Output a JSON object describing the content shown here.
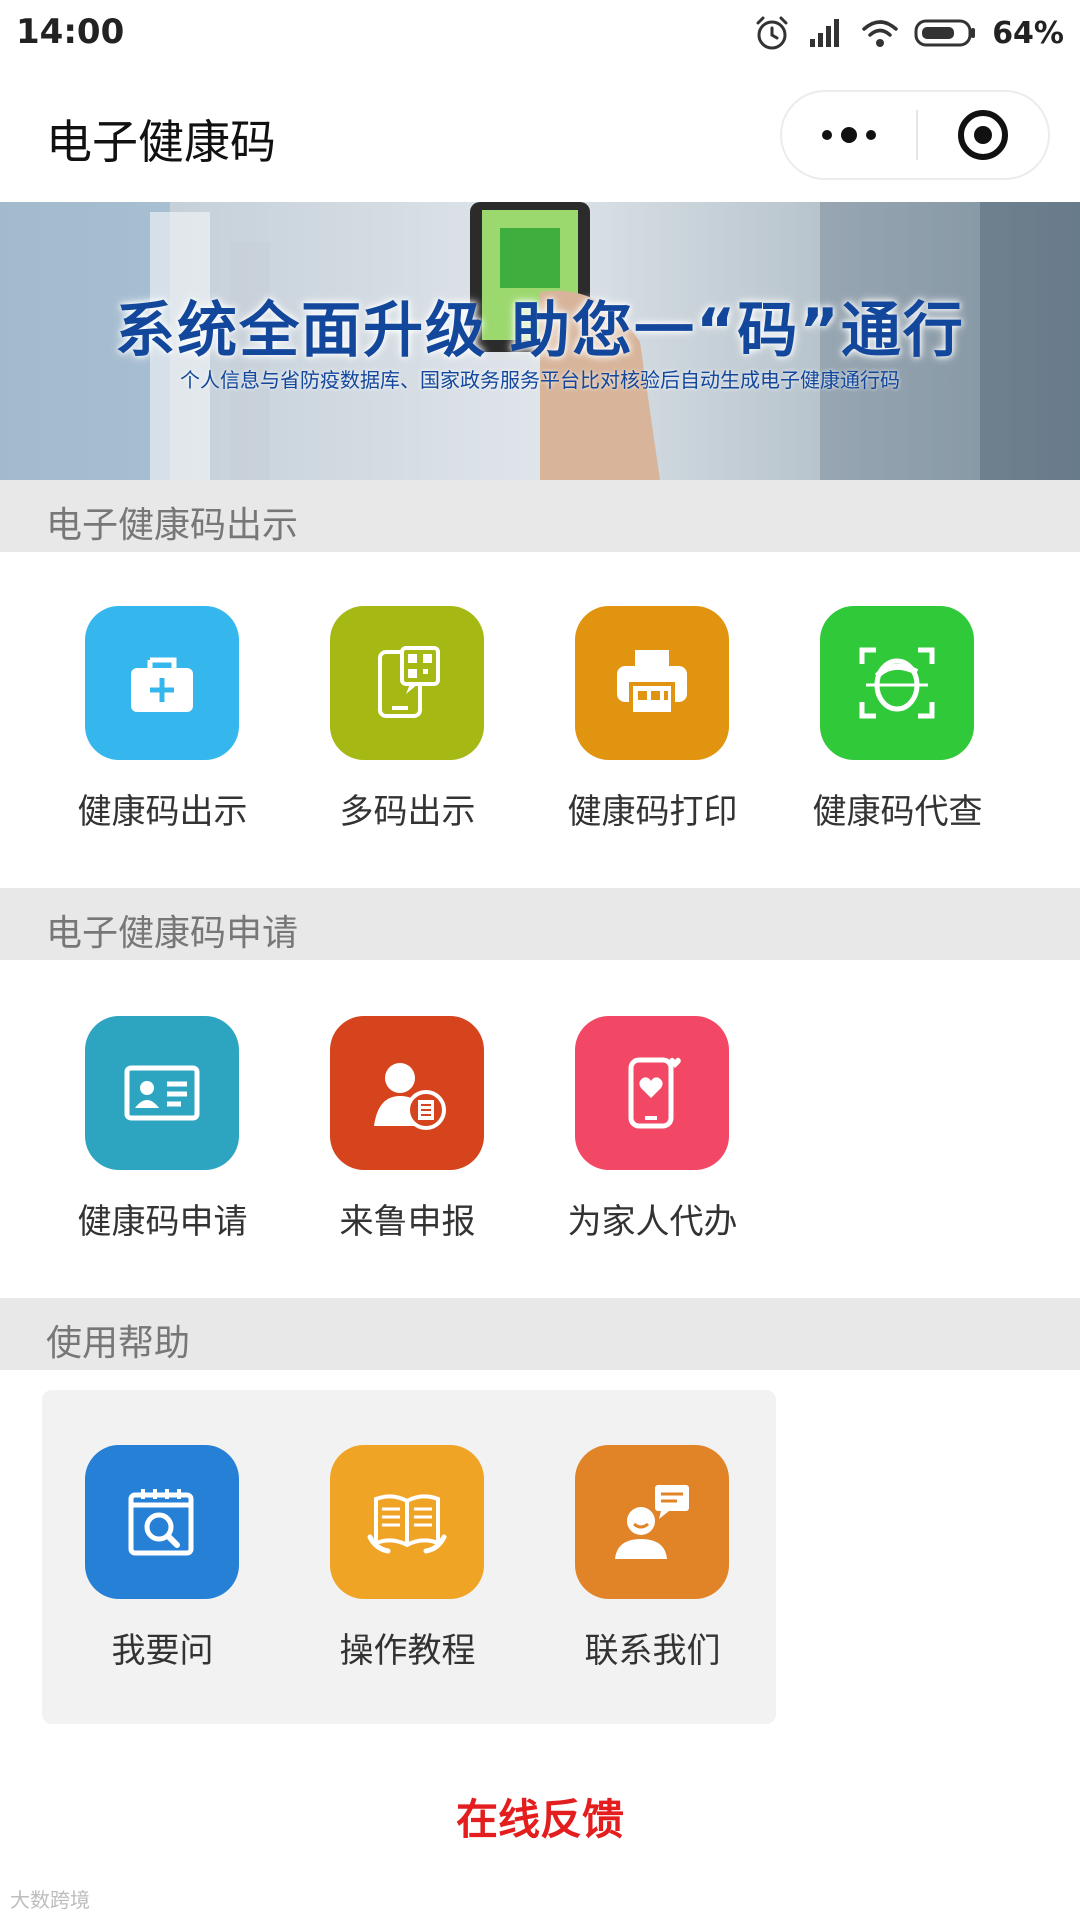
{
  "status_bar": {
    "time": "14:00",
    "battery": "64%"
  },
  "nav": {
    "title": "电子健康码"
  },
  "banner": {
    "headline": "系统全面升级  助您一“码”通行",
    "subtitle": "个人信息与省防疫数据库、国家政务服务平台比对核验后自动生成电子健康通行码"
  },
  "sections": [
    {
      "title": "电子健康码出示",
      "items": [
        {
          "label": "健康码出示",
          "icon": "medical-kit-icon",
          "color": "#35b7ee"
        },
        {
          "label": "多码出示",
          "icon": "phone-qr-icon",
          "color": "#a5b813"
        },
        {
          "label": "健康码打印",
          "icon": "printer-icon",
          "color": "#e0940f"
        },
        {
          "label": "健康码代查",
          "icon": "face-scan-icon",
          "color": "#2fc93a"
        }
      ]
    },
    {
      "title": "电子健康码申请",
      "items": [
        {
          "label": "健康码申请",
          "icon": "id-card-icon",
          "color": "#2ea5c0"
        },
        {
          "label": "来鲁申报",
          "icon": "person-document-icon",
          "color": "#d5441c"
        },
        {
          "label": "为家人代办",
          "icon": "phone-heart-icon",
          "color": "#f24866"
        }
      ]
    },
    {
      "title": "使用帮助",
      "items": [
        {
          "label": "我要问",
          "icon": "calendar-search-icon",
          "color": "#2680d6"
        },
        {
          "label": "操作教程",
          "icon": "open-book-icon",
          "color": "#f0a426"
        },
        {
          "label": "联系我们",
          "icon": "customer-service-icon",
          "color": "#e08427"
        }
      ]
    }
  ],
  "footer": {
    "feedback": "在线反馈",
    "watermark": "大数跨境"
  }
}
